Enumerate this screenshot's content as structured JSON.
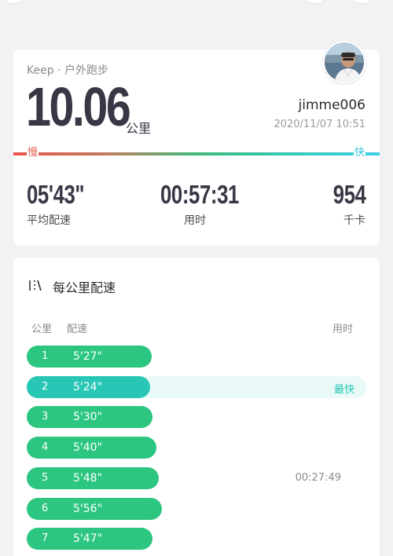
{
  "header": {
    "brand": "Keep · 户外跑步"
  },
  "run": {
    "distance": "10.06",
    "distance_unit": "公里",
    "username": "jimme006",
    "datetime": "2020/11/07 10:51"
  },
  "pace_scale": {
    "slow_label": "慢",
    "fast_label": "快",
    "colors": [
      "#e8554e",
      "#3fb978",
      "#3ad0e4"
    ]
  },
  "stats": [
    {
      "value": "05'43\"",
      "label": "平均配速"
    },
    {
      "value": "00:57:31",
      "label": "用时"
    },
    {
      "value": "954",
      "label": "千卡"
    }
  ],
  "splits": {
    "title": "每公里配速",
    "col_km": "公里",
    "col_pace": "配速",
    "col_time": "用时",
    "best_label": "最快",
    "rows": [
      {
        "km": "1",
        "pace": "5'27\"",
        "bar_fraction": 0.367,
        "note": ""
      },
      {
        "km": "2",
        "pace": "5'24\"",
        "bar_fraction": 0.364,
        "note": "最快"
      },
      {
        "km": "3",
        "pace": "5'30\"",
        "bar_fraction": 0.371,
        "note": ""
      },
      {
        "km": "4",
        "pace": "5'40\"",
        "bar_fraction": 0.381,
        "note": ""
      },
      {
        "km": "5",
        "pace": "5'48\"",
        "bar_fraction": 0.39,
        "note": "00:27:49"
      },
      {
        "km": "6",
        "pace": "5'56\"",
        "bar_fraction": 0.399,
        "note": ""
      },
      {
        "km": "7",
        "pace": "5'47\"",
        "bar_fraction": 0.371,
        "note": ""
      }
    ]
  }
}
